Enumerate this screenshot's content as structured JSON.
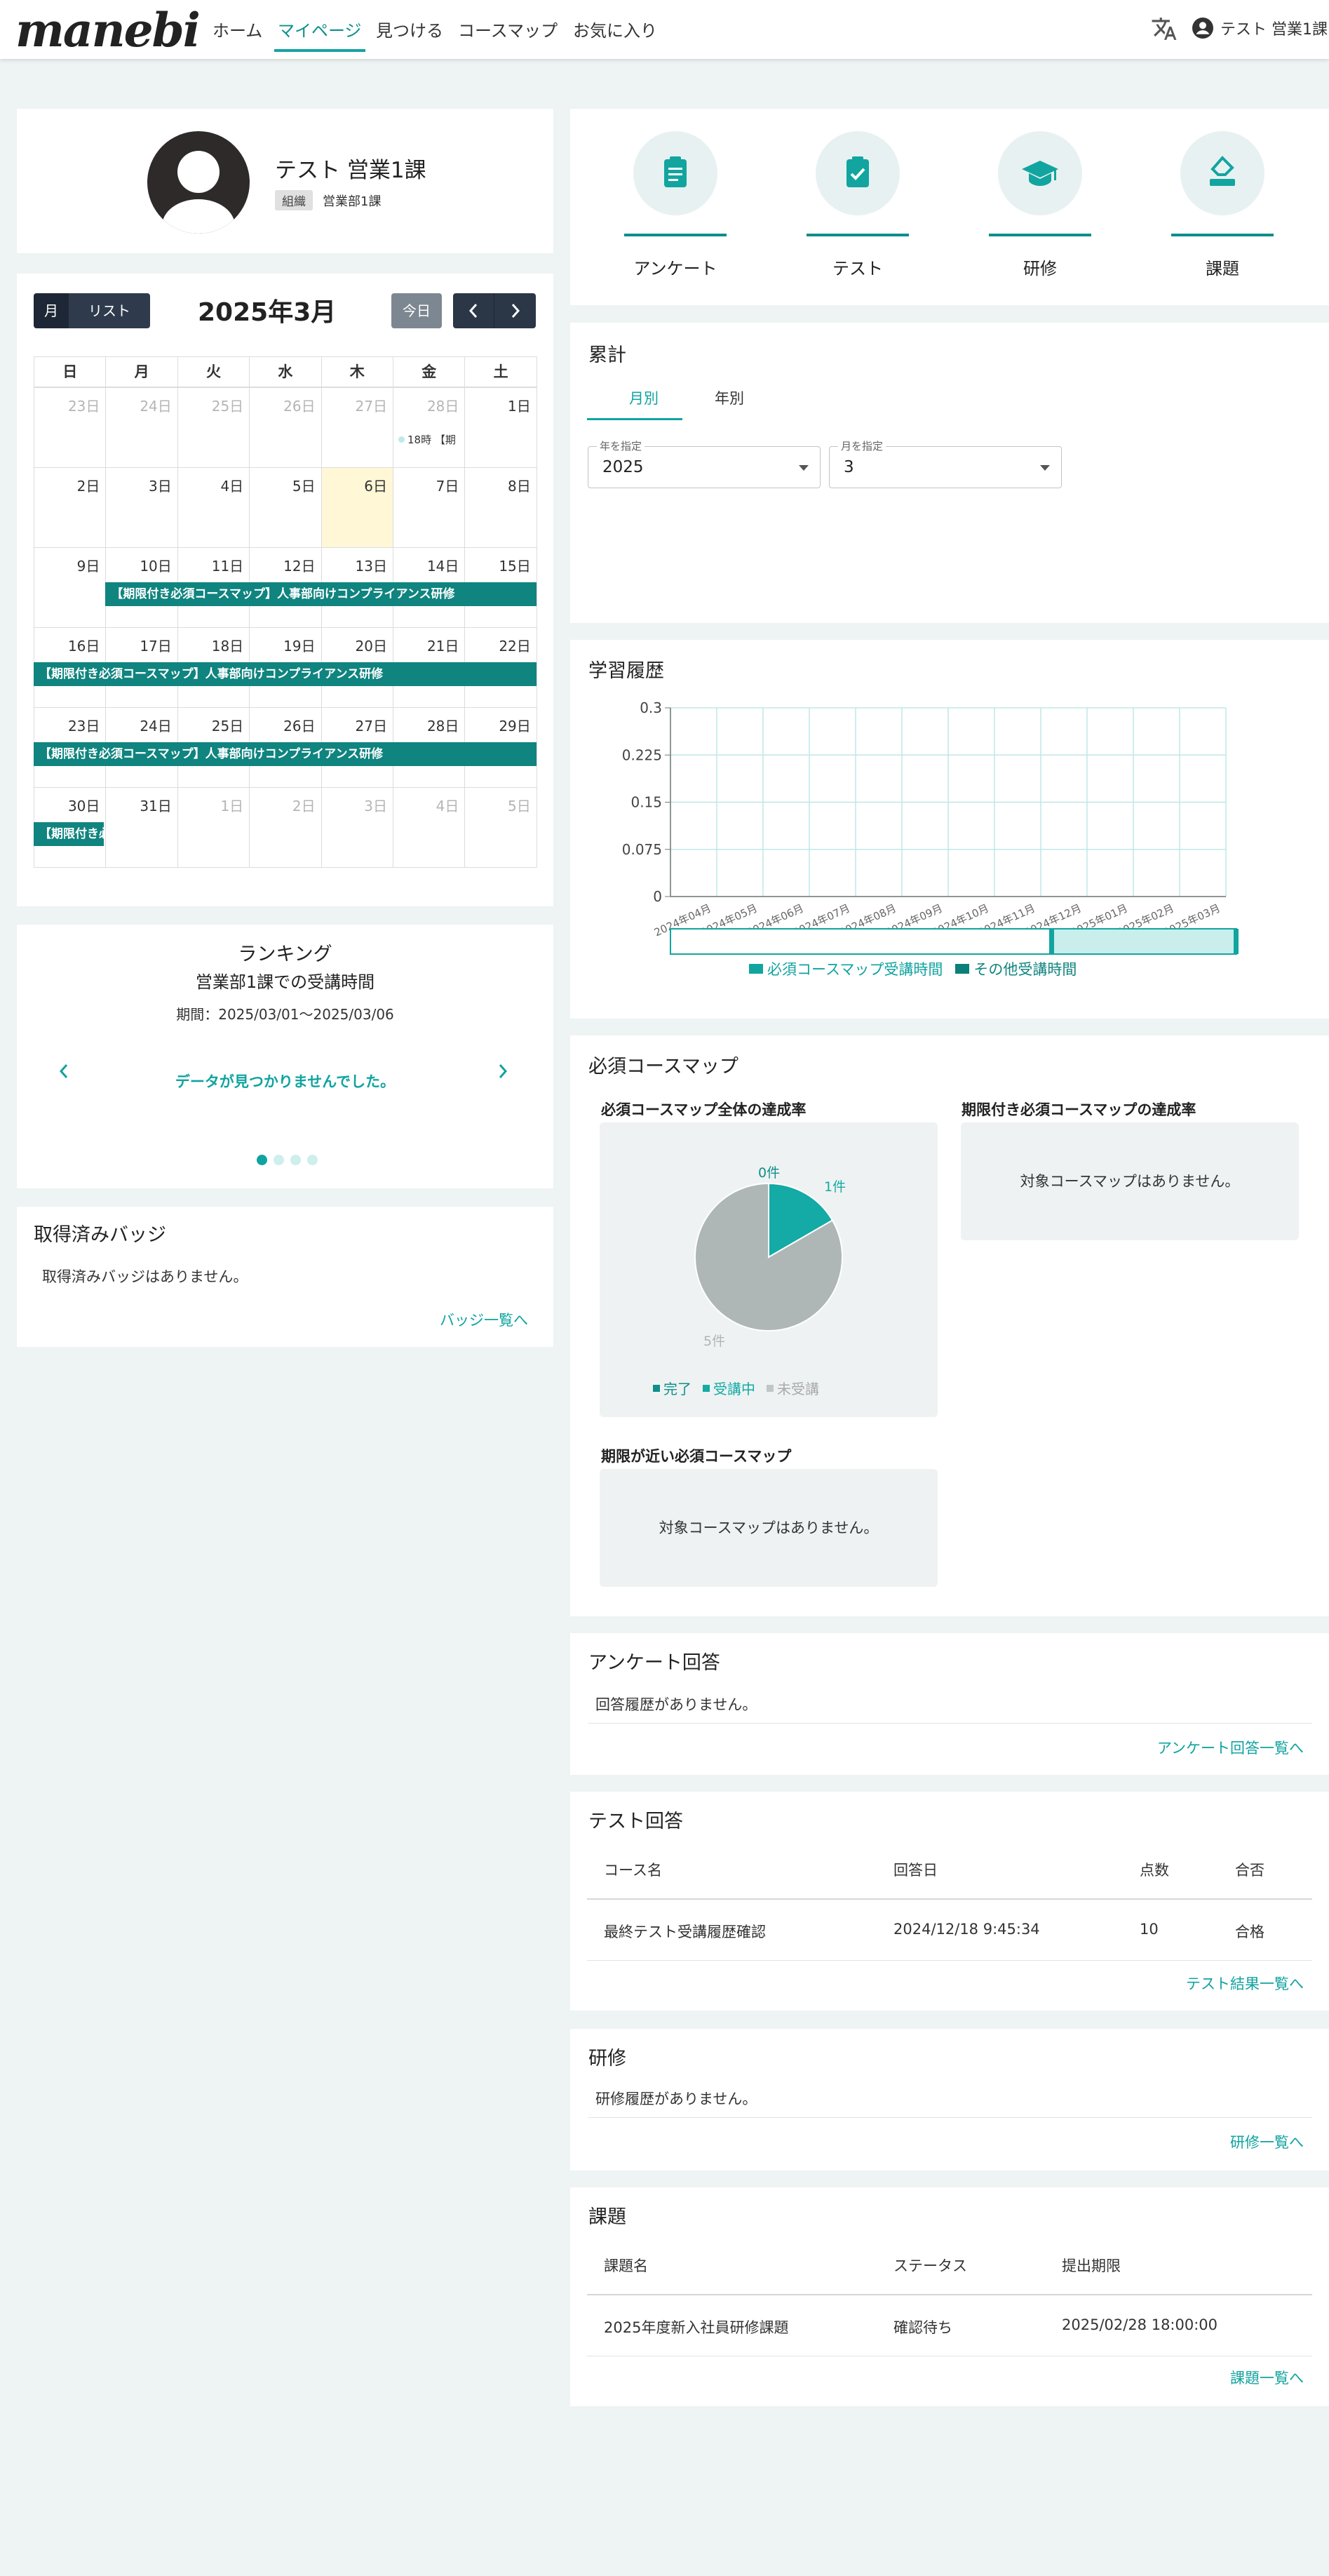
{
  "header": {
    "logo": "manebi",
    "nav": [
      "ホーム",
      "マイページ",
      "見つける",
      "コースマップ",
      "お気に入り"
    ],
    "user_name": "テスト 営業1課"
  },
  "profile": {
    "name": "テスト 営業1課",
    "org_badge": "組織",
    "org_name": "営業部1課"
  },
  "calendar": {
    "view_month": "月",
    "view_list": "リスト",
    "title": "2025年3月",
    "today_button": "今日",
    "weekdays": [
      "日",
      "月",
      "火",
      "水",
      "木",
      "金",
      "土"
    ],
    "weeks": [
      [
        "23日",
        "24日",
        "25日",
        "26日",
        "27日",
        "28日",
        "1日"
      ],
      [
        "2日",
        "3日",
        "4日",
        "5日",
        "6日",
        "7日",
        "8日"
      ],
      [
        "9日",
        "10日",
        "11日",
        "12日",
        "13日",
        "14日",
        "15日"
      ],
      [
        "16日",
        "17日",
        "18日",
        "19日",
        "20日",
        "21日",
        "22日"
      ],
      [
        "23日",
        "24日",
        "25日",
        "26日",
        "27日",
        "28日",
        "29日"
      ],
      [
        "30日",
        "31日",
        "1日",
        "2日",
        "3日",
        "4日",
        "5日"
      ]
    ],
    "timed_event": "18時 【期",
    "event_title": "【期限付き必須コースマップ】人事部向けコンプライアンス研修",
    "event_short": "【期限付き必"
  },
  "ranking": {
    "title": "ランキング",
    "subtitle": "営業部1課での受講時間",
    "period": "期間：2025/03/01〜2025/03/06",
    "empty": "データが見つかりませんでした。"
  },
  "badges": {
    "title": "取得済みバッジ",
    "empty": "取得済みバッジはありません。",
    "link": "バッジ一覧へ"
  },
  "quick_links": [
    "アンケート",
    "テスト",
    "研修",
    "課題"
  ],
  "totals": {
    "title": "累計",
    "tab_month": "月別",
    "tab_year": "年別",
    "year_label": "年を指定",
    "year_value": "2025",
    "month_label": "月を指定",
    "month_value": "3"
  },
  "history": {
    "title": "学習履歴",
    "legend": [
      "必須コースマップ受講時間",
      "その他受講時間"
    ]
  },
  "chart_data": {
    "type": "bar",
    "categories": [
      "2024年04月",
      "2024年05月",
      "2024年06月",
      "2024年07月",
      "2024年08月",
      "2024年09月",
      "2024年10月",
      "2024年11月",
      "2024年12月",
      "2025年01月",
      "2025年02月",
      "2025年03月"
    ],
    "series": [
      {
        "name": "必須コースマップ受講時間",
        "values": [
          0,
          0,
          0,
          0,
          0,
          0,
          0,
          0,
          0,
          0,
          0,
          0
        ]
      },
      {
        "name": "その他受講時間",
        "values": [
          0,
          0,
          0,
          0,
          0,
          0,
          0,
          0,
          0,
          0,
          0,
          0
        ]
      }
    ],
    "yticks": [
      "0",
      "0.075",
      "0.15",
      "0.225",
      "0.3"
    ],
    "ylim": [
      0,
      0.3
    ]
  },
  "required": {
    "title": "必須コースマップ",
    "overall_title": "必須コースマップ全体の達成率",
    "pie_labels": [
      "0件",
      "1件",
      "5件"
    ],
    "pie_values": [
      0,
      1,
      5
    ],
    "pie_colors": [
      "#0f8f8b",
      "#14aaa5",
      "#aeb6b6"
    ],
    "legend": [
      "完了",
      "受講中",
      "未受講"
    ],
    "deadline_title": "期限付き必須コースマップの達成率",
    "deadline_empty": "対象コースマップはありません。",
    "near_title": "期限が近い必須コースマップ",
    "near_empty": "対象コースマップはありません。"
  },
  "survey": {
    "title": "アンケート回答",
    "empty": "回答履歴がありません。",
    "link": "アンケート回答一覧へ"
  },
  "test": {
    "title": "テスト回答",
    "columns": [
      "コース名",
      "回答日",
      "点数",
      "合否"
    ],
    "rows": [
      [
        "最終テスト受講履歴確認",
        "2024/12/18 9:45:34",
        "10",
        "合格"
      ]
    ],
    "link": "テスト結果一覧へ"
  },
  "training": {
    "title": "研修",
    "empty": "研修履歴がありません。",
    "link": "研修一覧へ"
  },
  "assignment": {
    "title": "課題",
    "columns": [
      "課題名",
      "ステータス",
      "提出期限"
    ],
    "rows": [
      [
        "2025年度新入社員研修課題",
        "確認待ち",
        "2025/02/28 18:00:00"
      ]
    ],
    "link": "課題一覧へ"
  },
  "colors": {
    "accent": "#10a3a0",
    "event": "#10847f",
    "dark": "#2b3646"
  }
}
